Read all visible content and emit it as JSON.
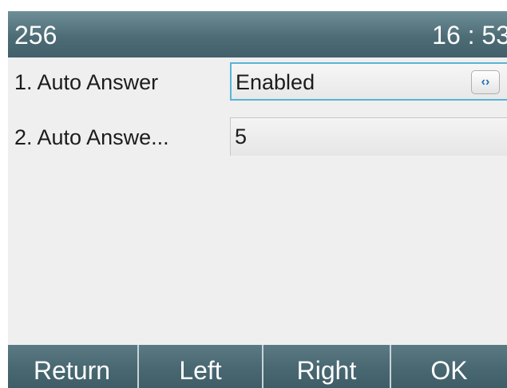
{
  "statusbar": {
    "extension": "256",
    "time": "16 : 53"
  },
  "settings": [
    {
      "index": "1.",
      "label": "1.  Auto Answer",
      "value": "Enabled",
      "icon": "left-right-switch-icon"
    },
    {
      "index": "2.",
      "label": "2.  Auto Answe...",
      "value": "5"
    }
  ],
  "softkeys": {
    "return": "Return",
    "left": "Left",
    "right": "Right",
    "ok": "OK"
  },
  "colors": {
    "statusbar": "#4d6c76",
    "focus_border": "#5ab4d6",
    "background": "#efefef",
    "icon_accent": "#1f6fb4"
  }
}
